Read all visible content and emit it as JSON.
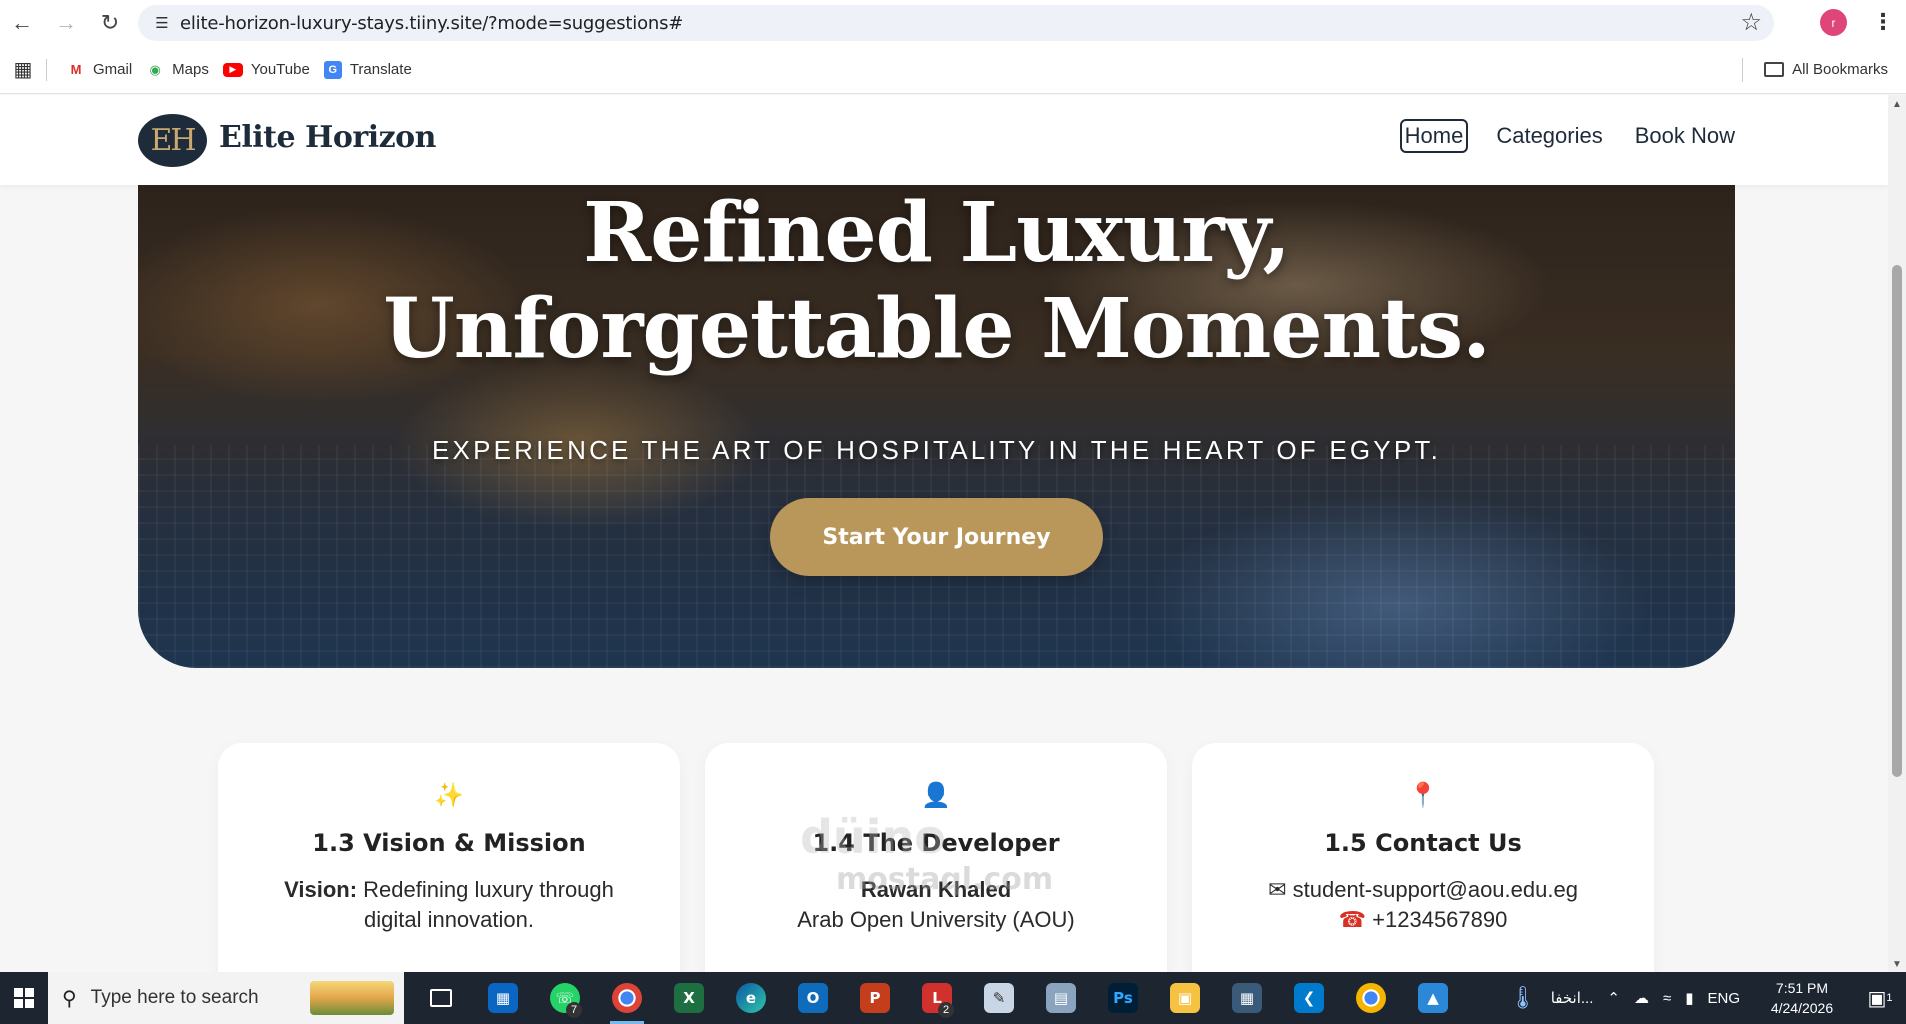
{
  "browser": {
    "url": "elite-horizon-luxury-stays.tiiny.site/?mode=suggestions#",
    "profile_initial": "r",
    "bookmarks": [
      {
        "label": "Gmail",
        "icon": "gmail-icon"
      },
      {
        "label": "Maps",
        "icon": "maps-icon"
      },
      {
        "label": "YouTube",
        "icon": "youtube-icon"
      },
      {
        "label": "Translate",
        "icon": "translate-icon"
      }
    ],
    "all_bookmarks_label": "All Bookmarks"
  },
  "site": {
    "logo_initials": "EH",
    "brand": "Elite Horizon",
    "nav": [
      "Home",
      "Categories",
      "Book Now"
    ],
    "active_nav": "Home",
    "accent_color": "#b9975b",
    "navy_color": "#1d2b3a"
  },
  "hero": {
    "title_line1": "Refined Luxury,",
    "title_line2": "Unforgettable Moments.",
    "subtitle": "EXPERIENCE THE ART OF HOSPITALITY IN THE HEART OF EGYPT.",
    "cta": "Start Your Journey"
  },
  "cards": [
    {
      "icon": "sparkles-icon",
      "icon_glyph": "✨",
      "title": "1.3 Vision & Mission",
      "label": "Vision:",
      "line1": "Redefining luxury through",
      "line2": "digital innovation."
    },
    {
      "icon": "developer-icon",
      "icon_glyph": "👤",
      "title": "1.4 The Developer",
      "name": "Rawan Khaled",
      "line2": "Arab Open University (AOU)"
    },
    {
      "icon": "location-pin-icon",
      "icon_glyph": "📍",
      "title": "1.5 Contact Us",
      "email": "student-support@aou.edu.eg",
      "phone": "+1234567890"
    }
  ],
  "watermark": {
    "line1": "düino",
    "line2": "mostaql.com"
  },
  "taskbar": {
    "search_placeholder": "Type here to search",
    "apps": [
      {
        "icon": "task-view-icon"
      },
      {
        "icon": "store-icon"
      },
      {
        "icon": "whatsapp-icon",
        "badge": "7"
      },
      {
        "icon": "chrome-icon",
        "active": true
      },
      {
        "icon": "excel-icon"
      },
      {
        "icon": "edge-icon"
      },
      {
        "icon": "outlook-icon"
      },
      {
        "icon": "powerpoint-icon"
      },
      {
        "icon": "l-app-icon",
        "badge": "2"
      },
      {
        "icon": "paint-icon"
      },
      {
        "icon": "scanner-icon"
      },
      {
        "icon": "photoshop-icon"
      },
      {
        "icon": "file-explorer-icon"
      },
      {
        "icon": "network-map-icon"
      },
      {
        "icon": "vscode-icon"
      },
      {
        "icon": "chrome-icon-2"
      },
      {
        "icon": "photos-icon"
      }
    ],
    "weather_text": "انخفا...",
    "language": "ENG",
    "time": "7:51 PM",
    "date": "4/24/2026",
    "notification_count": "1"
  }
}
